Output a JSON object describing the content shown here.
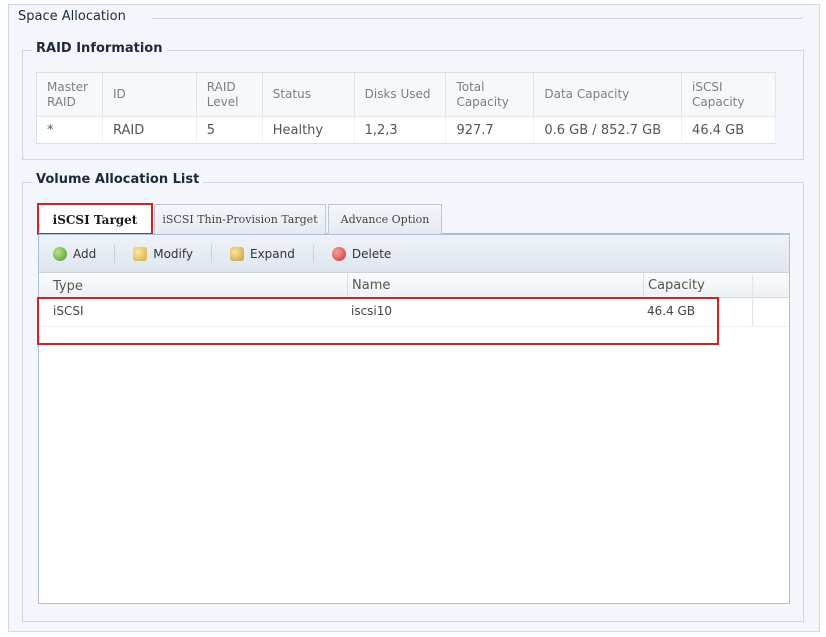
{
  "space_allocation": {
    "title": "Space Allocation"
  },
  "raid_info": {
    "title": "RAID Information",
    "columns": [
      "Master RAID",
      "ID",
      "RAID Level",
      "Status",
      "Disks Used",
      "Total Capacity",
      "Data Capacity",
      "iSCSI Capacity"
    ],
    "rows": [
      [
        "*",
        "RAID",
        "5",
        "Healthy",
        "1,2,3",
        "927.7",
        "0.6 GB / 852.7 GB",
        "46.4 GB"
      ]
    ]
  },
  "volume_allocation": {
    "title": "Volume Allocation List",
    "tabs": [
      {
        "label": "iSCSI Target",
        "active": true
      },
      {
        "label": "iSCSI Thin-Provision Target",
        "active": false
      },
      {
        "label": "Advance Option",
        "active": false
      }
    ],
    "toolbar": {
      "add": "Add",
      "modify": "Modify",
      "expand": "Expand",
      "delete": "Delete"
    },
    "grid": {
      "columns": [
        "Type",
        "Name",
        "Capacity"
      ],
      "rows": [
        [
          "iSCSI",
          "iscsi10",
          "46.4 GB"
        ]
      ]
    }
  },
  "colors": {
    "highlight": "#d42020",
    "panel_bg": "#f3f6fb",
    "tab_border": "#aac0da"
  }
}
